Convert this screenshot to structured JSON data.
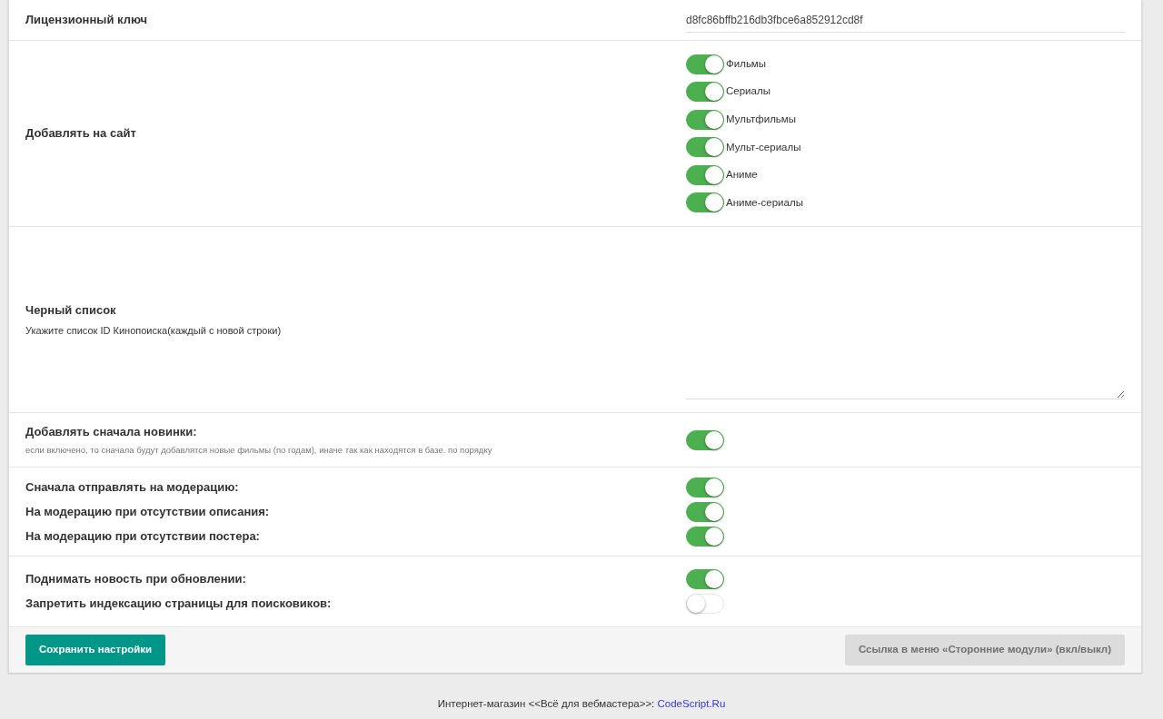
{
  "sections": [
    {
      "kind": "key",
      "label": "Лицензионный ключ",
      "value": "d8fc86bffb216db3fbce6a852912cd8f"
    },
    {
      "kind": "checklist",
      "label": "Добавлять на сайт",
      "options": [
        {
          "label": "Фильмы",
          "on": true
        },
        {
          "label": "Сериалы",
          "on": true
        },
        {
          "label": "Мультфильмы",
          "on": true
        },
        {
          "label": "Мульт-сериалы",
          "on": true
        },
        {
          "label": "Аниме",
          "on": true
        },
        {
          "label": "Аниме-сериалы",
          "on": true
        }
      ]
    },
    {
      "kind": "textarea",
      "label": "Черный список",
      "hint": "Укажите список ID Кинопоиска(каждый с новой строки)"
    },
    {
      "kind": "switches",
      "hint": "если включено, то сначала будут добавлятся новые фильмы (по годам), иначе так как находятся в базе. по порядку",
      "items": [
        {
          "label": "Добавлять сначала новинки:",
          "on": true
        }
      ]
    },
    {
      "kind": "switches",
      "items": [
        {
          "label": "Сначала отправлять на модерацию:",
          "on": true
        },
        {
          "label": "На модерацию при отсутствии описания:",
          "on": true
        },
        {
          "label": "На модерацию при отсутствии постера:",
          "on": true
        }
      ]
    },
    {
      "kind": "switches",
      "items": [
        {
          "label": "Поднимать новость при обновлении:",
          "on": true
        },
        {
          "label": "Запретить индексацию страницы для поисковиков:",
          "on": false
        }
      ]
    }
  ],
  "actions": {
    "save": {
      "label": "Сохранить настройки"
    },
    "menu_link": {
      "label": "Ссылка в меню «Сторонние модули» (вкл/выкл)",
      "disabled": true
    }
  },
  "footer": {
    "text": "Интернет-магазин <<Всё для вебмастера>>:",
    "link": "CodeScript.Ru"
  }
}
